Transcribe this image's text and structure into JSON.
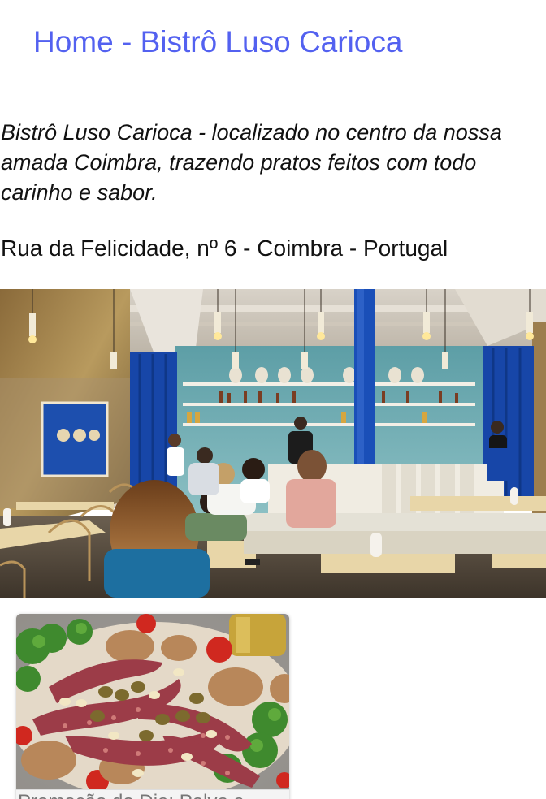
{
  "header": {
    "title": "Home - Bistrô Luso Carioca"
  },
  "intro": {
    "text": "Bistrô Luso Carioca - localizado no centro da nossa amada Coimbra, trazendo pratos feitos com todo carinho e sabor."
  },
  "address": {
    "text": "Rua da Felicidade, nº 6 - Coimbra - Portugal"
  },
  "hero": {
    "alt": "restaurant-interior-photo"
  },
  "promo": {
    "caption": "Promoção do Dia: Polvo a",
    "image_alt": "octopus-dish-photo"
  },
  "colors": {
    "title": "#5361f0",
    "curtain_blue": "#1746a8",
    "wall_teal": "#7fb3b8"
  }
}
